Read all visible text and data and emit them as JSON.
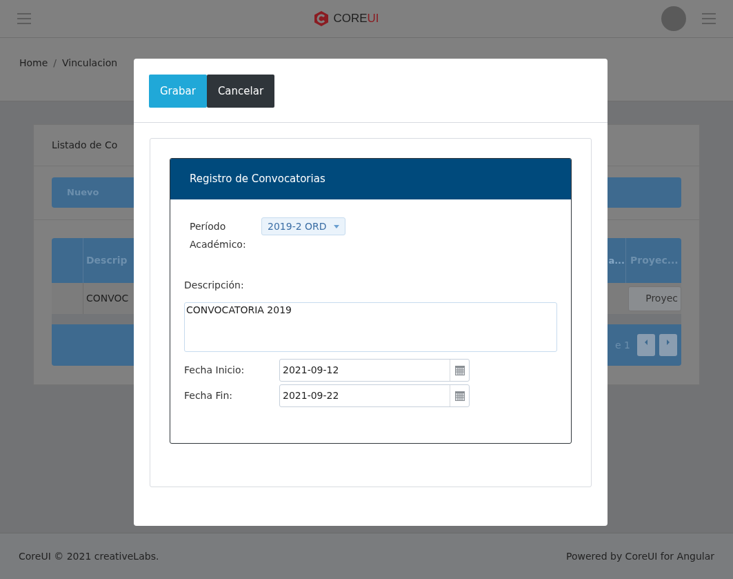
{
  "header": {
    "logo": {
      "prefix": "CORE",
      "suffix": "UI"
    }
  },
  "breadcrumb": {
    "items": [
      "Home",
      "Vinculacion"
    ],
    "separator": "/"
  },
  "card": {
    "title": "Listado de Co",
    "toolbar": [
      "Nuevo"
    ],
    "table": {
      "columns": [
        "Descrip",
        "a...",
        "Proyec..."
      ],
      "rows": [
        {
          "description": "CONVOC",
          "action": "Proyec"
        }
      ],
      "pager": "e 1"
    }
  },
  "modal": {
    "buttons": [
      {
        "label": "Grabar",
        "kind": "primary"
      },
      {
        "label": "Cancelar",
        "kind": "dark"
      }
    ],
    "panel": {
      "title": "Registro de Convocatorias",
      "period": {
        "label_lines": [
          "Período",
          "Académico:"
        ],
        "value": "2019-2 ORD"
      },
      "description": {
        "label": "Descripción:",
        "value": "CONVOCATORIA 2019"
      },
      "dates": [
        {
          "label": "Fecha Inicio:",
          "value": "2021-09-12"
        },
        {
          "label": "Fecha Fin:",
          "value": "2021-09-22"
        }
      ]
    }
  },
  "footer": {
    "left": "CoreUI © 2021 creativeLabs.",
    "right": "Powered by CoreUI for Angular"
  }
}
